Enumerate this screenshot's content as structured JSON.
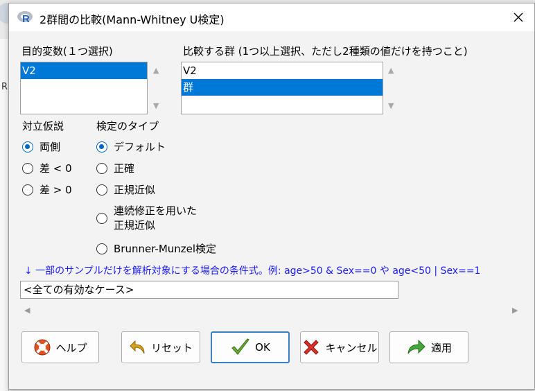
{
  "window": {
    "title": "2群間の比較(Mann-Whitney U検定)",
    "logo_letter": "R"
  },
  "background": {
    "side_letter": "R"
  },
  "target_var": {
    "label": "目的変数(１つ選択)",
    "items": [
      "V2"
    ]
  },
  "group_var": {
    "label": "比較する群 (1つ以上選択、ただし2種類の値だけを持つこと)",
    "items": [
      "V2",
      "群"
    ]
  },
  "alternative": {
    "label": "対立仮説",
    "options": [
      "両側",
      "差 < 0",
      "差 > 0"
    ],
    "selected": "両側"
  },
  "test_type": {
    "label": "検定のタイプ",
    "options": [
      "デフォルト",
      "正確",
      "正規近似",
      "連続修正を用いた\n正規近似",
      "Brunner-Munzel検定"
    ],
    "selected": "デフォルト"
  },
  "subset": {
    "info": "↓ 一部のサンプルだけを解析対象にする場合の条件式。例: age>50 & Sex==0 や age<50 | Sex==1",
    "value": "<全ての有効なケース>"
  },
  "buttons": {
    "help": "ヘルプ",
    "reset": "リセット",
    "ok": "OK",
    "cancel": "キャンセル",
    "apply": "適用"
  },
  "colors": {
    "selection": "#0078d7",
    "info_text": "#1a1aff",
    "radio_on": "#0067c0"
  }
}
